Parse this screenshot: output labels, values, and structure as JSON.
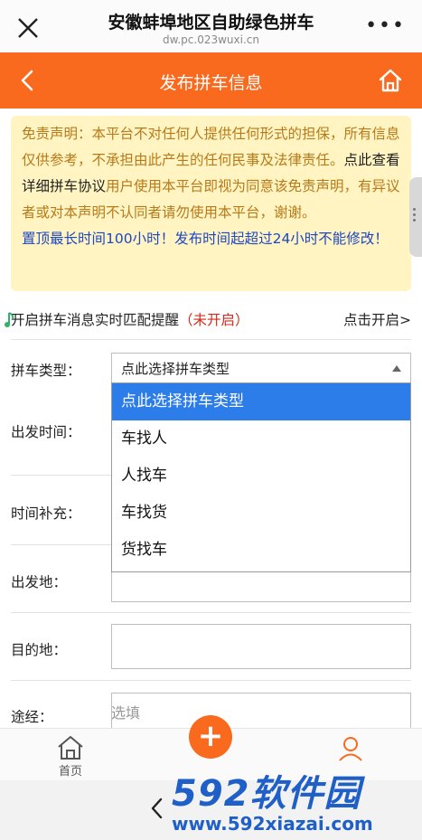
{
  "topbar": {
    "title": "安徽蚌埠地区自助绿色拼车",
    "url": "dw.pc.023wuxi.cn",
    "more": "•••"
  },
  "header": {
    "title": "发布拼车信息"
  },
  "disclaimer": {
    "intro": "免责声明：本平台不对任何人提供任何形式的担保，所有信息仅供参考，不承担由此产生的任何民事及法律责任。",
    "link_text": "点此查看详细拼车协议",
    "tail": "用户使用本平台即视为同意该免责声明，有异议者或对本声明不认同者请勿使用本平台，谢谢。",
    "notice": "置顶最长时间100小时！发布时间起超过24小时不能修改！"
  },
  "alert": {
    "label": "开启拼车消息实时匹配提醒",
    "status": "（未开启）",
    "action": "点击开启>"
  },
  "form": {
    "type_label": "拼车类型：",
    "type_value": "点此选择拼车类型",
    "type_options": [
      "点此选择拼车类型",
      "车找人",
      "人找车",
      "车找货",
      "货找车"
    ],
    "time_label": "出发时间：",
    "time_extra_label": "时间补充：",
    "origin_label": "出发地：",
    "destination_label": "目的地：",
    "via_label": "途经：",
    "via_placeholder": "选填"
  },
  "bottomnav": {
    "home_label": "首页",
    "fab_symbol": "+"
  },
  "watermark": {
    "big": "592软件园",
    "small": "www.592xiazai.com"
  },
  "colors": {
    "accent": "#fa6a1e",
    "selected": "#2c7ce9",
    "notice_blue": "#1d47c4",
    "warn_red": "#d22c1e"
  }
}
